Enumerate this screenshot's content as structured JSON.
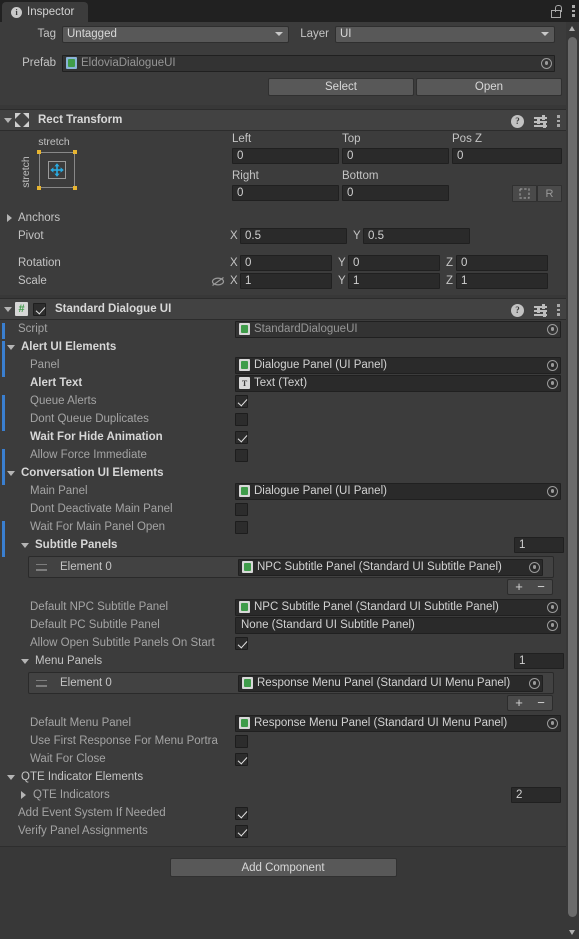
{
  "window": {
    "tab_label": "Inspector",
    "tab_icon": "info-icon",
    "lock_icon": "lock-icon",
    "menu_icon": "kebab-menu-icon"
  },
  "header": {
    "tag_label": "Tag",
    "tag_value": "Untagged",
    "layer_label": "Layer",
    "layer_value": "UI",
    "prefab_label": "Prefab",
    "prefab_value": "EldoviaDialogueUI",
    "select_label": "Select",
    "open_label": "Open"
  },
  "rect_transform": {
    "title": "Rect Transform",
    "anchor_top_label": "stretch",
    "anchor_left_label": "stretch",
    "left_label": "Left",
    "left_value": "0",
    "top_label": "Top",
    "top_value": "0",
    "posz_label": "Pos Z",
    "posz_value": "0",
    "right_label": "Right",
    "right_value": "0",
    "bottom_label": "Bottom",
    "bottom_value": "0",
    "blueprint_label": "",
    "raw_label": "R",
    "anchors_label": "Anchors",
    "pivot_label": "Pivot",
    "pivot_x_axis": "X",
    "pivot_x": "0.5",
    "pivot_y_axis": "Y",
    "pivot_y": "0.5",
    "rotation_label": "Rotation",
    "rotation_x_axis": "X",
    "rotation_x": "0",
    "rotation_y_axis": "Y",
    "rotation_y": "0",
    "rotation_z_axis": "Z",
    "rotation_z": "0",
    "scale_label": "Scale",
    "scale_x_axis": "X",
    "scale_x": "1",
    "scale_y_axis": "Y",
    "scale_y": "1",
    "scale_z_axis": "Z",
    "scale_z": "1"
  },
  "dialogue_ui": {
    "title": "Standard Dialogue UI",
    "enabled": true,
    "script_label": "Script",
    "script_value": "StandardDialogueUI",
    "alert_section": "Alert UI Elements",
    "alert_panel_label": "Panel",
    "alert_panel_value": "Dialogue Panel (UI Panel)",
    "alert_text_label": "Alert Text",
    "alert_text_value": "Text (Text)",
    "queue_alerts_label": "Queue Alerts",
    "dont_queue_dup_label": "Dont Queue Duplicates",
    "wait_hide_anim_label": "Wait For Hide Animation",
    "allow_force_immediate_label": "Allow Force Immediate",
    "conversation_section": "Conversation UI Elements",
    "main_panel_label": "Main Panel",
    "main_panel_value": "Dialogue Panel (UI Panel)",
    "dont_deactivate_label": "Dont Deactivate Main Panel",
    "wait_main_open_label": "Wait For Main Panel Open",
    "subtitle_panels_label": "Subtitle Panels",
    "subtitle_panels_size": "1",
    "subtitle_element_0_label": "Element 0",
    "subtitle_element_0_value": "NPC Subtitle Panel (Standard UI Subtitle Panel)",
    "default_npc_label": "Default NPC Subtitle Panel",
    "default_npc_value": "NPC Subtitle Panel (Standard UI Subtitle Panel)",
    "default_pc_label": "Default PC Subtitle Panel",
    "default_pc_value": "None (Standard UI Subtitle Panel)",
    "allow_open_subtitle_label": "Allow Open Subtitle Panels On Start",
    "menu_panels_label": "Menu Panels",
    "menu_panels_size": "1",
    "menu_element_0_label": "Element 0",
    "menu_element_0_value": "Response Menu Panel (Standard UI Menu Panel)",
    "default_menu_label": "Default Menu Panel",
    "default_menu_value": "Response Menu Panel (Standard UI Menu Panel)",
    "use_first_response_label": "Use First Response For Menu Portra",
    "wait_for_close_label": "Wait For Close",
    "qte_section": "QTE Indicator Elements",
    "qte_indicators_label": "QTE Indicators",
    "qte_indicators_size": "2",
    "add_event_system_label": "Add Event System If Needed",
    "verify_panel_label": "Verify Panel Assignments",
    "add_plus": "+",
    "add_minus": "−"
  },
  "footer": {
    "add_component_label": "Add Component"
  },
  "colors": {
    "background": "#383838",
    "panel": "#3c3c3c",
    "header": "#424242",
    "override_blue": "#3a7fd0",
    "script_green": "#3f9c4a",
    "anchor_yellow": "#e8b530",
    "anchor_blue": "#29abe2"
  }
}
